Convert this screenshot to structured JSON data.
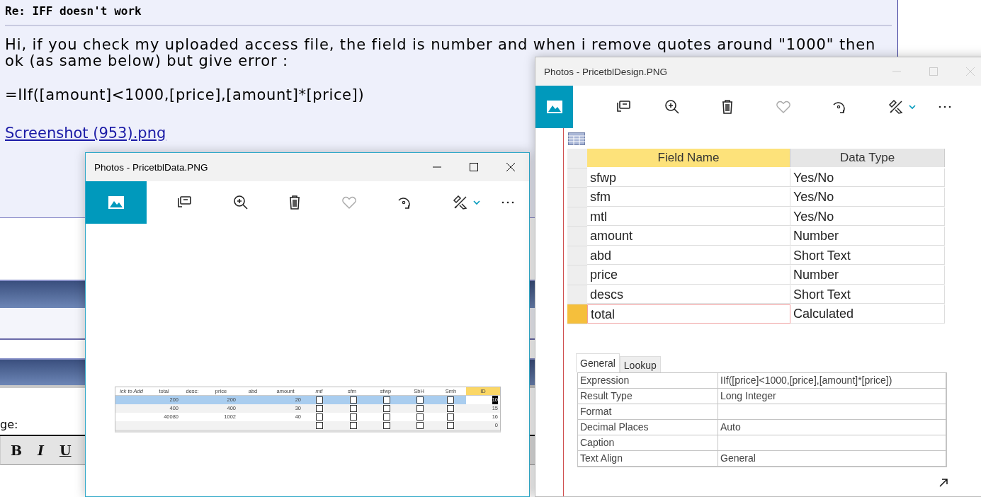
{
  "post": {
    "title": "Re: IFF doesn't work",
    "body": "Hi, if you check my uploaded access file, the field is number and when i remove quotes around \"1000\" then ok (as same below) but give error :",
    "formula": "=IIf([amount]<1000,[price],[amount]*[price])",
    "link": "Screenshot (953).png"
  },
  "editor": {
    "label": "ge:",
    "format_buttons": [
      {
        "label": "B",
        "kind": "bold"
      },
      {
        "label": "I",
        "kind": "italic"
      },
      {
        "label": "U",
        "kind": "underline"
      }
    ]
  },
  "windows": [
    {
      "kind": "datasheet",
      "title": "Photos - PricetblData.PNG",
      "active": true,
      "columns": [
        {
          "label": "ick to Add",
          "selected": false
        },
        {
          "label": "total",
          "selected": false
        },
        {
          "label": "desc:",
          "selected": false
        },
        {
          "label": "price",
          "selected": false
        },
        {
          "label": "abd",
          "selected": false
        },
        {
          "label": "amount",
          "selected": false
        },
        {
          "label": "mtl",
          "selected": false
        },
        {
          "label": "sfm",
          "selected": false
        },
        {
          "label": "sfwp",
          "selected": false
        },
        {
          "label": "SbH",
          "selected": false
        },
        {
          "label": "Smh",
          "selected": false
        },
        {
          "label": "ID",
          "selected": true
        }
      ],
      "rows": [
        {
          "selected": true,
          "cells": [
            null,
            "200",
            null,
            "200",
            null,
            "20",
            false,
            false,
            false,
            false,
            false,
            "10"
          ]
        },
        {
          "selected": false,
          "cells": [
            null,
            "400",
            null,
            "400",
            null,
            "30",
            false,
            false,
            false,
            false,
            false,
            "15"
          ]
        },
        {
          "selected": false,
          "cells": [
            null,
            "40080",
            null,
            "1002",
            null,
            "40",
            false,
            false,
            false,
            false,
            false,
            "16"
          ]
        },
        {
          "selected": false,
          "cells": [
            null,
            null,
            null,
            null,
            null,
            null,
            false,
            false,
            false,
            false,
            false,
            "0"
          ]
        }
      ]
    },
    {
      "kind": "design",
      "title": "Photos - PricetblDesign.PNG",
      "active": false,
      "headers": [
        "Field Name",
        "Data Type"
      ],
      "fields": [
        {
          "name": "sfwp",
          "type": "Yes/No",
          "selected": false
        },
        {
          "name": "sfm",
          "type": "Yes/No",
          "selected": false
        },
        {
          "name": "mtl",
          "type": "Yes/No",
          "selected": false
        },
        {
          "name": "amount",
          "type": "Number",
          "selected": false
        },
        {
          "name": "abd",
          "type": "Short Text",
          "selected": false
        },
        {
          "name": "price",
          "type": "Number",
          "selected": false
        },
        {
          "name": "descs",
          "type": "Short Text",
          "selected": false
        },
        {
          "name": "total",
          "type": "Calculated",
          "selected": true
        }
      ],
      "property_tabs": [
        {
          "label": "General",
          "selected": true
        },
        {
          "label": "Lookup",
          "selected": false
        }
      ],
      "properties": [
        {
          "label": "Expression",
          "value": "IIf([price]<1000,[price],[amount]*[price])"
        },
        {
          "label": "Result Type",
          "value": "Long Integer"
        },
        {
          "label": "Format"
        },
        {
          "label": "Decimal Places",
          "value": "Auto"
        },
        {
          "label": "Caption"
        },
        {
          "label": "Text Align",
          "value": "General"
        }
      ]
    }
  ]
}
